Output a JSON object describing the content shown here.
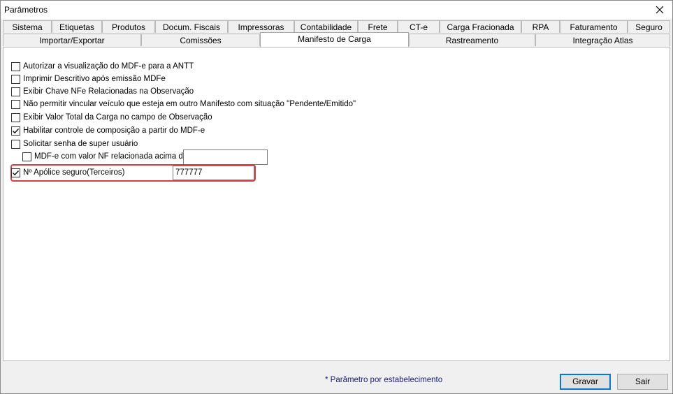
{
  "window": {
    "title": "Parâmetros"
  },
  "tabs": {
    "row1": [
      "Sistema",
      "Etiquetas",
      "Produtos",
      "Docum. Fiscais",
      "Impressoras",
      "Contabilidade",
      "Frete",
      "CT-e",
      "Carga Fracionada",
      "RPA",
      "Faturamento",
      "Seguro"
    ],
    "row2": [
      "Importar/Exportar",
      "Comissões",
      "Manifesto de Carga",
      "Rastreamento",
      "Integração Atlas"
    ],
    "active": "Manifesto de Carga"
  },
  "options": [
    {
      "label": "Autorizar a visualização do MDF-e para a ANTT",
      "checked": false
    },
    {
      "label": "Imprimir Descritivo após emissão MDFe",
      "checked": false
    },
    {
      "label": "Exibir Chave NFe Relacionadas na Observação",
      "checked": false
    },
    {
      "label": "Não permitir vincular veículo que esteja em outro Manifesto com situação \"Pendente/Emitido\"",
      "checked": false
    },
    {
      "label": "Exibir Valor Total da Carga no campo de Observação",
      "checked": false
    },
    {
      "label": "Habilitar controle de composição a partir do MDF-e",
      "checked": true
    },
    {
      "label": "Solicitar senha de super usuário",
      "checked": false
    }
  ],
  "sub_option": {
    "label": "MDF-e com valor NF relacionada acima de",
    "checked": false,
    "value": ""
  },
  "apolice": {
    "label": "Nº Apólice seguro(Terceiros)",
    "checked": true,
    "value": "777777"
  },
  "footer": {
    "note": "* Parâmetro por estabelecimento",
    "save_label": "Gravar",
    "exit_label": "Sair"
  },
  "colors": {
    "highlight": "#d64045",
    "default_button_border": "#0078d7",
    "note_text": "#1a1a80"
  }
}
